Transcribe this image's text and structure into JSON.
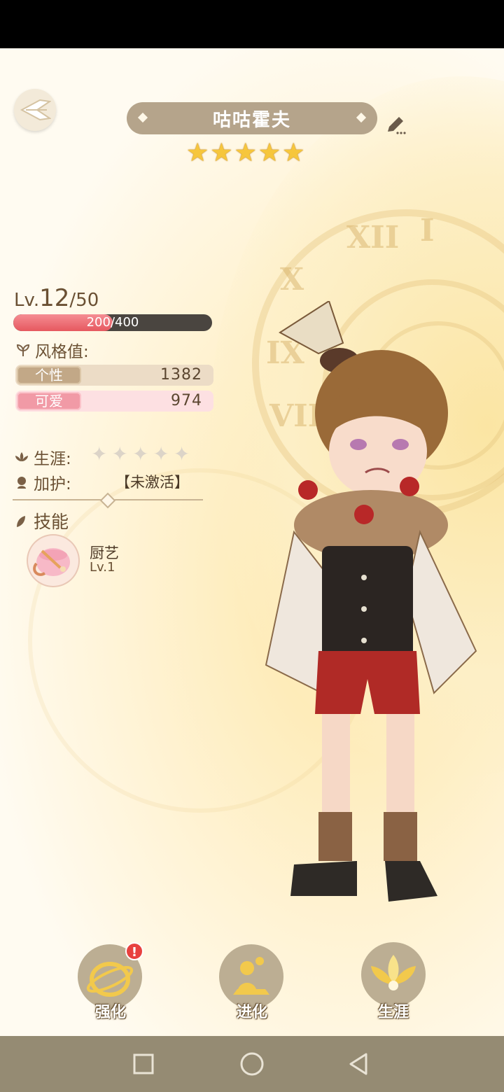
{
  "character": {
    "name": "咕咕霍夫",
    "stars": 5
  },
  "level": {
    "prefix": "Lv.",
    "current": "12",
    "max": "/50"
  },
  "xp": {
    "text": "200/400",
    "progress": 0.5
  },
  "style": {
    "label": "风格值:",
    "stats": [
      {
        "name": "个性",
        "value": "1382"
      },
      {
        "name": "可爱",
        "value": "974"
      }
    ]
  },
  "career": {
    "label": "生涯:",
    "stars_filled": 0,
    "stars_total": 5
  },
  "guard": {
    "label": "加护:",
    "value": "【未激活】"
  },
  "skills": {
    "label": "技能",
    "items": [
      {
        "name": "厨艺",
        "level": "Lv.1"
      }
    ]
  },
  "actions": [
    {
      "label": "强化",
      "badge": "!"
    },
    {
      "label": "进化"
    },
    {
      "label": "生涯"
    }
  ],
  "colors": {
    "accent_brown": "#b5a48b",
    "xp_fill": "#e6585f",
    "star": "#f6c63c",
    "badge": "#e8413f"
  }
}
